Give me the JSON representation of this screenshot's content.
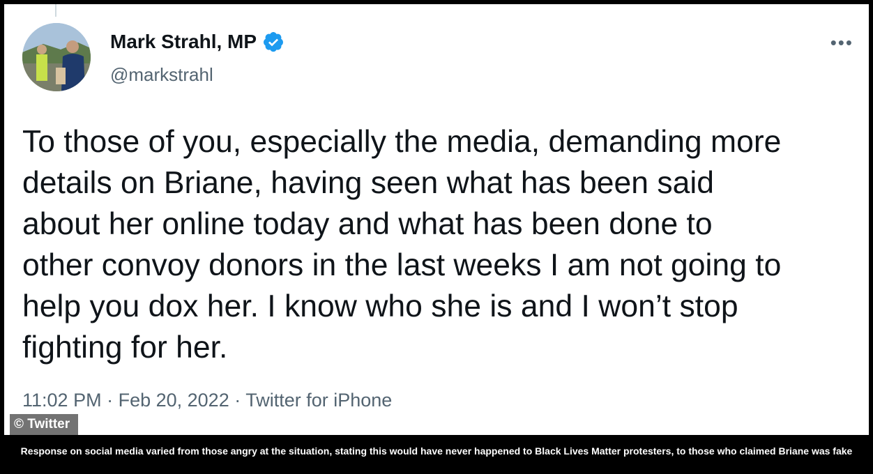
{
  "tweet": {
    "display_name": "Mark Strahl, MP",
    "handle": "@markstrahl",
    "more_label": "•••",
    "text": "To those of you, especially the media, demanding more\ndetails on Briane, having seen what has been said\nabout her online today and what has been done to\nother convoy donors in the last weeks I am not going to\nhelp you dox her. I know who she is and I won’t stop\nfighting for her.",
    "time": "11:02 PM",
    "date": "Feb 20, 2022",
    "source": "Twitter for iPhone",
    "separator": " · "
  },
  "watermark": "© Twitter",
  "caption": "Response on social media varied from those angry at the situation, stating this would have never happened to Black Lives Matter protesters, to those who claimed Briane was fake",
  "colors": {
    "verified_badge": "#1d9bf0",
    "primary_text": "#0f1419",
    "secondary_text": "#536471"
  },
  "icons": {
    "verified": "verified-badge-icon",
    "more": "more-options-icon"
  }
}
